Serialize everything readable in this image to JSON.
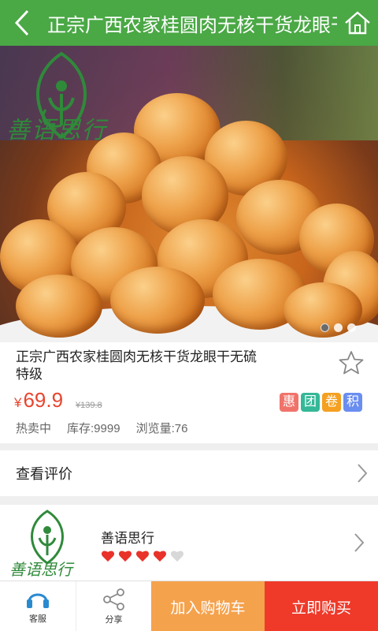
{
  "header": {
    "title": "正宗广西农家桂圆肉无核干货龙眼干无硫特级",
    "back_icon": "back-arrow-icon",
    "home_icon": "home-icon",
    "color": "#4aa845"
  },
  "hero": {
    "logo_text": "善语思行",
    "slides": 3,
    "active_slide": 1
  },
  "product": {
    "title": "正宗广西农家桂圆肉无核干货龙眼干无硫特级",
    "price_symbol": "¥",
    "price": "69.9",
    "old_price": "¥139.8",
    "tags": [
      {
        "label": "惠",
        "color": "#f0736a"
      },
      {
        "label": "团",
        "color": "#35b898"
      },
      {
        "label": "卷",
        "color": "#f5a020"
      },
      {
        "label": "积",
        "color": "#6a8ef0"
      }
    ],
    "status": "热卖中",
    "stock": "库存:9999",
    "views": "浏览量:76"
  },
  "review": {
    "label": "查看评价"
  },
  "shop": {
    "name": "善语思行",
    "logo_text": "善语思行",
    "rating": 4,
    "rating_max": 5
  },
  "bottom_bar": {
    "service_label": "客服",
    "share_label": "分享",
    "cart_label": "加入购物车",
    "buy_label": "立即购买"
  },
  "colors": {
    "price": "#e8452f",
    "cart": "#f5a24d",
    "buy": "#ef3a2a"
  }
}
